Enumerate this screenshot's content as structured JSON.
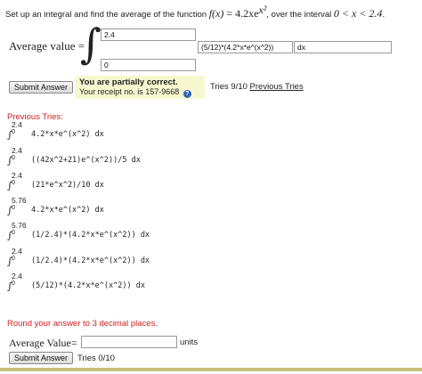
{
  "problem": {
    "prefix": "Set up an integral and find the average of the function",
    "fx": "f(x)",
    "eq": " = 4.2xe",
    "exp": "x²",
    "mid": ", over the interval",
    "interval": "0 < x < 2.4",
    "end": "."
  },
  "setup": {
    "average_label": "Average value =",
    "integral_sign": "∫",
    "upper_limit": "2.4",
    "lower_limit": "0",
    "integrand": "(5/12)*(4.2*x*e^(x^2))",
    "dx": "dx"
  },
  "submit1": {
    "label": "Submit Answer",
    "feedback_title": "You are partially correct.",
    "receipt": "Your receipt no. is 157-9668",
    "info_icon": "?",
    "tries": "Tries 9/10",
    "previous_link": "Previous Tries"
  },
  "previous_tries": {
    "heading": "Previous Tries:",
    "items": [
      {
        "upper": "2.4",
        "lower": "0",
        "expr": "4.2*x*e^(x^2) dx"
      },
      {
        "upper": "2.4",
        "lower": "0",
        "expr": "((42x^2+21)e^(x^2))/5 dx"
      },
      {
        "upper": "2.4",
        "lower": "0",
        "expr": "(21*e^x^2)/10 dx"
      },
      {
        "upper": "5.76",
        "lower": "0",
        "expr": "4.2*x*e^(x^2) dx"
      },
      {
        "upper": "5.76",
        "lower": "0",
        "expr": "(1/2.4)*(4.2*x*e^(x^2)) dx"
      },
      {
        "upper": "2.4",
        "lower": "0",
        "expr": "(1/2.4)*(4.2*x*e^(x^2)) dx"
      },
      {
        "upper": "2.4",
        "lower": "0",
        "expr": "(5/12)*(4.2*x*e^(x^2)) dx"
      }
    ]
  },
  "answer": {
    "round_note": "Round your answer to 3 decimal places.",
    "label": "Average Value=",
    "value": "",
    "units": "units",
    "submit_label": "Submit Answer",
    "tries": "Tries 0/10"
  },
  "colors": {
    "error_red": "#d02020",
    "feedback_bg": "#f8f8d0",
    "info_blue": "#2a62b5"
  }
}
